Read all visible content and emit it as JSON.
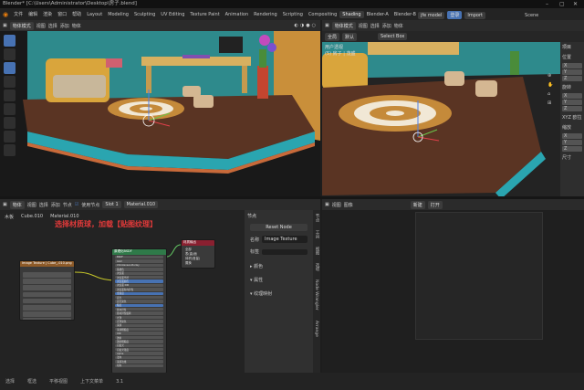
{
  "window": {
    "title": "Blender* [C:\\Users\\Administrator\\Desktop\\房子.blend]"
  },
  "menu": {
    "items": [
      "文件",
      "编辑",
      "渲染",
      "窗口",
      "帮助"
    ]
  },
  "workspaces": [
    "Layout",
    "Modeling",
    "Sculpting",
    "UV Editing",
    "Texture Paint",
    "Animation",
    "Rendering",
    "Scripting",
    "Compositing",
    "Shading",
    "Blender-A",
    "Blender-B"
  ],
  "active_workspace": "Shading",
  "top_right": {
    "model_label": "jfe model",
    "btn1": "登录",
    "btn2": "Import",
    "scene": "Scene"
  },
  "viewport_left": {
    "mode": "物体模式",
    "view": "视图",
    "select": "选择",
    "add": "添加",
    "object": "物体"
  },
  "viewport_right": {
    "mode": "物体模式",
    "view": "视图",
    "select": "选择",
    "add": "添加",
    "object": "物体",
    "global": "全局",
    "default": "默认",
    "select_box": "Select Box",
    "overlay_title": "用户透视",
    "overlay_sub": "(5) 房子 | 茂盛",
    "n_panel": {
      "header": "项目",
      "loc_label": "位置",
      "rot_label": "旋转",
      "xyz_label": "XYZ 欧拉",
      "scale_label": "缩放",
      "dims_label": "尺寸",
      "axes": [
        "X",
        "Y",
        "Z"
      ]
    }
  },
  "node_editor": {
    "header": {
      "type": "物体",
      "view": "视图",
      "select": "选择",
      "add": "添加",
      "node": "节点",
      "use_nodes": "使用节点",
      "slot": "Slot 1",
      "material": "Material.010"
    },
    "breadcrumb": {
      "object": "木板",
      "mesh": "Cube.010",
      "material": "Material.010"
    },
    "annotation": "选择材质球，加载【贴图纹理】",
    "image_node": {
      "title": "Image Texture | Cube_.010.png"
    },
    "bsdf": {
      "title": "原理化BSDF",
      "rows": [
        "BSDF",
        "GGX",
        "Christensen-Burley",
        "基础色",
        "次表面",
        "次表面半径",
        "次表面颜色",
        "次表面 IOR",
        "次表面各向异性",
        "金属度",
        "高光",
        "高光染色",
        "糙度",
        "各向异性",
        "各向异性旋转",
        "光泽",
        "光泽染色",
        "清漆",
        "清漆粗糙度",
        "IOR",
        "透射",
        "透射粗糙度",
        "自发光",
        "自发光强度",
        "Alpha",
        "法向",
        "清漆法线",
        "切向"
      ]
    },
    "output": {
      "title": "材质输出",
      "rows": [
        "全部",
        "表(曲)面",
        "体积(音量)",
        "置换"
      ]
    },
    "n_panel": {
      "header": "节点",
      "reset": "Reset Node",
      "name_label": "名称",
      "name_value": "Image Texture",
      "label_label": "标签",
      "color_section": "颜色",
      "props_section": "属性",
      "texture_section": "纹理映射"
    },
    "tabs": [
      "节点",
      "工具",
      "视图",
      "选项",
      "Node Wrangler",
      "Arrange"
    ]
  },
  "image_editor": {
    "view": "视图",
    "image": "图像",
    "new": "新建",
    "open": "打开"
  },
  "status_bar": {
    "items": [
      "选择",
      "框选",
      "平移视图",
      "上下文菜单",
      "3.1"
    ]
  }
}
